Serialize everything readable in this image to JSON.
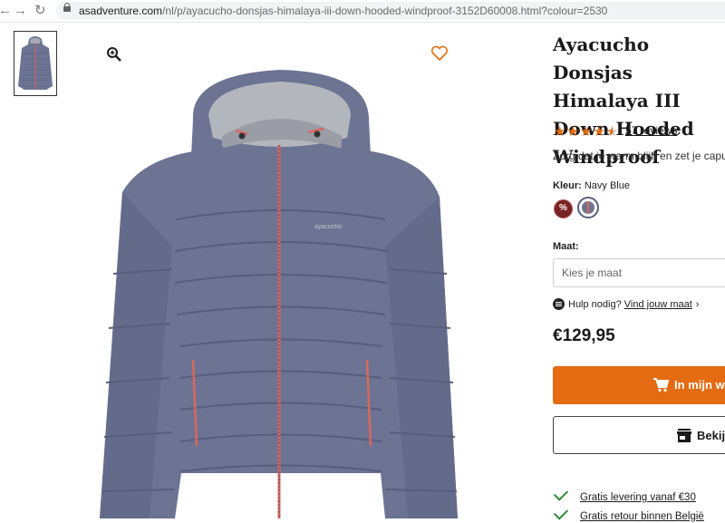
{
  "browser": {
    "url_domain": "asadventure.com",
    "url_path": "/nl/p/ayacucho-donsjas-himalaya-iii-down-hooded-windproof-3152D60008.html?colour=2530",
    "back_icon": "back-arrow-icon",
    "forward_icon": "forward-arrow-icon",
    "reload_icon": "reload-icon"
  },
  "product": {
    "title": "Ayacucho Donsjas Himalaya III Down Hooded Windproof",
    "rating": 4.5,
    "reviews_label": "57 reviews",
    "description": "Zorg dat je warm blijft en zet je capuchon",
    "color_label": "Kleur:",
    "color_value": "Navy Blue",
    "swatch_sale_text": "%",
    "size_label": "Maat:",
    "size_placeholder": "Kies je maat",
    "help_text": "Hulp nodig?",
    "help_link": "Vind jouw maat",
    "price": "€129,95",
    "cart_button": "In mijn win",
    "store_button": "Bekijk",
    "usps": [
      {
        "text": "Gratis levering vanaf €30"
      },
      {
        "text": "Gratis retour binnen België"
      }
    ]
  },
  "colors": {
    "accent": "#e46b12",
    "jacket": "#6c7393",
    "zipper": "#d8685e",
    "check": "#2f8a36"
  }
}
